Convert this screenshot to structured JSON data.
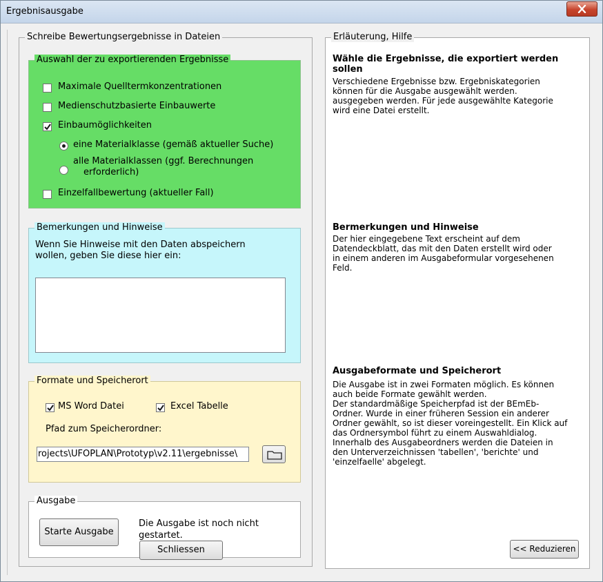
{
  "window": {
    "title": "Ergebnisausgabe"
  },
  "left_panel": {
    "legend": "Schreibe Bewertungsergebnisse in Dateien",
    "selection": {
      "legend": "Auswahl der zu exportierenden Ergebnisse",
      "options": [
        {
          "label": "Maximale Quelltermkonzentrationen",
          "checked": false
        },
        {
          "label": "Medienschutzbasierte Einbauwerte",
          "checked": false
        },
        {
          "label": "Einbaumöglichkeiten",
          "checked": true
        }
      ],
      "radio_options": [
        {
          "label": "eine Materialklasse (gemäß aktueller Suche)",
          "selected": true
        },
        {
          "label_line1": "alle Materialklassen (ggf. Berechnungen",
          "label_line2": "erforderlich)",
          "selected": false
        }
      ],
      "case_option": {
        "label": "Einzelfallbewertung (aktueller Fall)",
        "checked": false
      }
    },
    "remarks": {
      "legend": "Bemerkungen und Hinweise",
      "instruction_line1": "Wenn Sie Hinweise mit den Daten abspeichern",
      "instruction_line2": "wollen, geben Sie diese hier ein:",
      "text_value": ""
    },
    "formats": {
      "legend": "Formate und Speicherort",
      "word_label": "MS Word Datei",
      "word_checked": true,
      "excel_label": "Excel Tabelle",
      "excel_checked": true,
      "path_label": "Pfad zum Speicherordner:",
      "path_value": "rojects\\UFOPLAN\\Prototyp\\v2.11\\ergebnisse\\"
    },
    "output": {
      "legend": "Ausgabe",
      "start_button": "Starte Ausgabe",
      "status_line1": "Die Ausgabe ist noch nicht",
      "status_line2": "gestartet."
    },
    "close_button": "Schliessen"
  },
  "right_panel": {
    "legend": "Erläuterung, Hilfe",
    "section1": {
      "title_line1": "Wähle die Ergebnisse, die exportiert werden",
      "title_line2": "sollen",
      "lines": [
        "Verschiedene Ergebnisse bzw. Ergebniskategorien",
        "können für die Ausgabe ausgewählt werden.",
        "ausgegeben werden. Für jede ausgewählte Kategorie",
        "wird eine Datei erstellt."
      ]
    },
    "section2": {
      "title": "Bermerkungen und Hinweise",
      "lines": [
        "Der hier eingegebene Text erscheint auf dem",
        "Datendeckblatt, das mit den Daten erstellt wird oder",
        "in einem anderen im Ausgabeformular vorgesehenen",
        "Feld."
      ]
    },
    "section3": {
      "title": "Ausgabeformate und Speicherort",
      "lines": [
        "Die Ausgabe ist in zwei Formaten möglich. Es können",
        "auch beide Formate gewählt werden.",
        "Der standardmäßige Speicherpfad ist der BEmEb-",
        "Ordner. Wurde in einer früheren Session ein anderer",
        "Ordner gewählt, so ist dieser voreingestellt. Ein Klick auf",
        "das Ordnersymbol führt zu einem Auswahldialog.",
        "Innerhalb des Ausgabeordners werden die Dateien in",
        "den Unterverzeichnissen 'tabellen', 'berichte' und",
        "'einzelfaelle' abgelegt."
      ]
    },
    "reduce_button": "<< Reduzieren"
  },
  "icons": {
    "close": "close-icon",
    "folder": "folder-icon",
    "check": "checkmark-icon"
  },
  "colors": {
    "selection_bg": "#66dd66",
    "remarks_bg": "#c6f6fb",
    "formats_bg": "#fff6cc"
  }
}
